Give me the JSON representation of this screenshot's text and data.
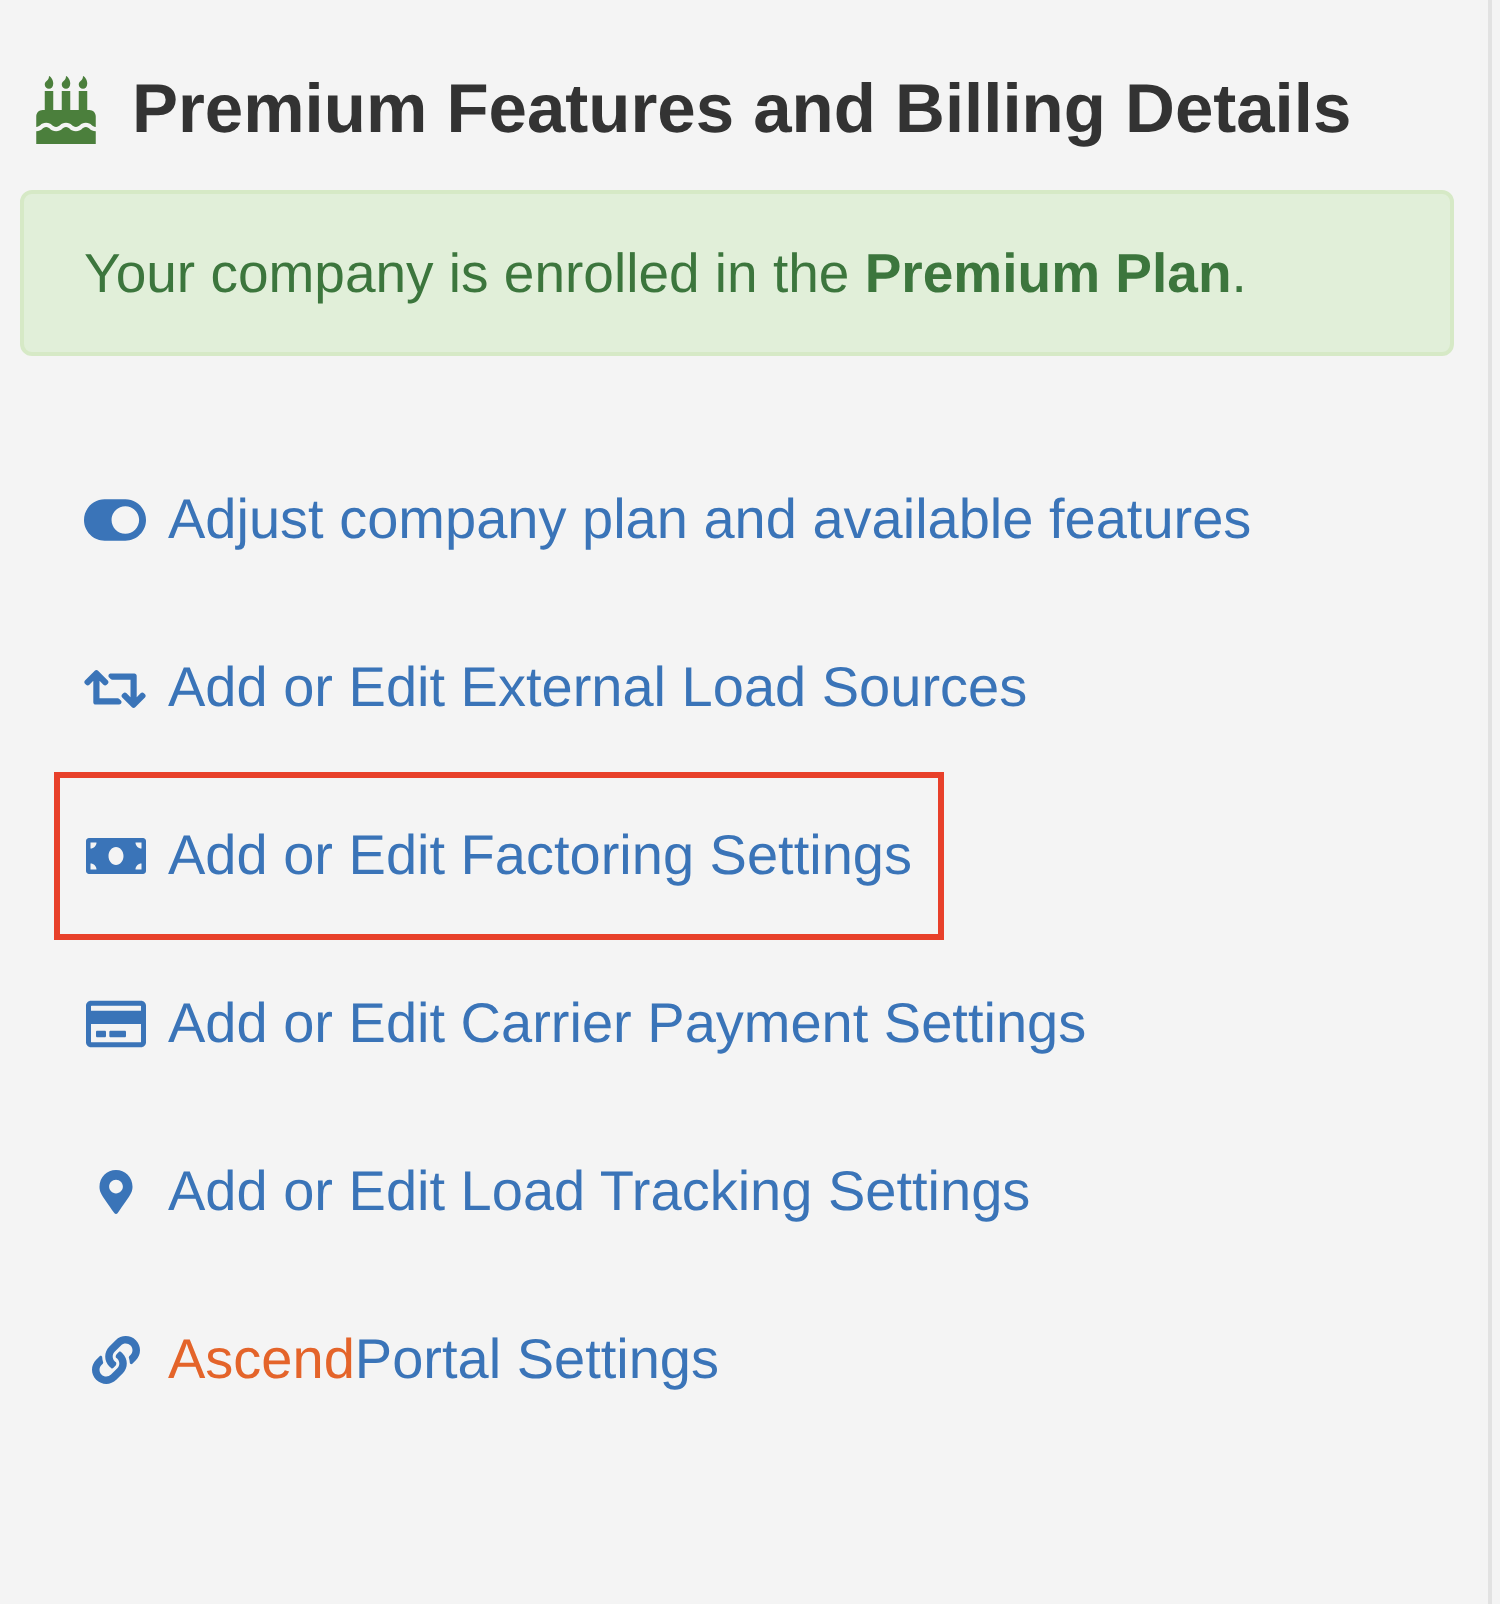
{
  "heading": {
    "title": "Premium Features and Billing Details"
  },
  "alert": {
    "message": "Your company is enrolled in the **Premium Plan**."
  },
  "links": [
    {
      "kind": "toggle",
      "label": "Adjust company plan and available features",
      "highlighted": false
    },
    {
      "kind": "sources",
      "label": "Add or Edit External Load Sources",
      "highlighted": false
    },
    {
      "kind": "factoring",
      "label": "Add or Edit Factoring Settings",
      "highlighted": true
    },
    {
      "kind": "payment",
      "label": "Add or Edit Carrier Payment Settings",
      "highlighted": false
    },
    {
      "kind": "tracking",
      "label": "Add or Edit Load Tracking Settings",
      "highlighted": false
    },
    {
      "kind": "portal",
      "brand_prefix": "Ascend",
      "label": "Portal Settings",
      "highlighted": false
    }
  ]
}
